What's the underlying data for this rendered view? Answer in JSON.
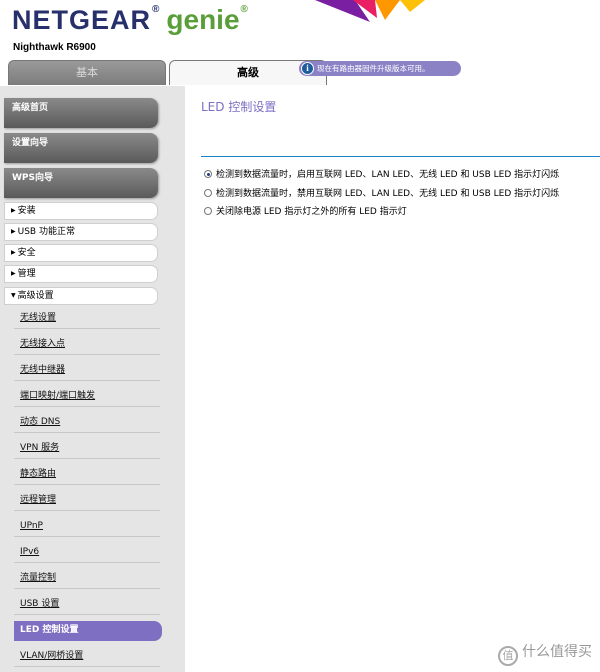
{
  "header": {
    "brand": "NETGEAR",
    "reg_mark": "®",
    "product": "genie",
    "product_reg": "®",
    "model": "Nighthawk R6900"
  },
  "tabs": [
    {
      "label": "基本",
      "active": false
    },
    {
      "label": "高级",
      "active": true
    }
  ],
  "notice": {
    "icon": "info-icon",
    "text": "现在有路由器固件升级版本可用。"
  },
  "sidebar": {
    "big_buttons": [
      "高级首页",
      "设置向导",
      "WPS向导"
    ],
    "menu": [
      {
        "label": "安装",
        "expanded": false
      },
      {
        "label": "USB 功能正常",
        "expanded": false
      },
      {
        "label": "安全",
        "expanded": false
      },
      {
        "label": "管理",
        "expanded": false
      },
      {
        "label": "高级设置",
        "expanded": true
      }
    ],
    "subitems": [
      "无线设置",
      "无线接入点",
      "无线中继器",
      "端口映射/端口触发",
      "动态 DNS",
      "VPN 服务",
      "静态路由",
      "远程管理",
      "UPnP",
      "IPv6",
      "流量控制",
      "USB 设置",
      "LED 控制设置",
      "VLAN/网桥设置"
    ],
    "active_subitem": "LED 控制设置"
  },
  "content": {
    "title": "LED 控制设置",
    "options": [
      {
        "label": "检测到数据流量时，启用互联网 LED、LAN LED、无线 LED 和 USB LED 指示灯闪烁",
        "checked": true
      },
      {
        "label": "检测到数据流量时，禁用互联网 LED、LAN LED、无线 LED 和 USB LED 指示灯闪烁",
        "checked": false
      },
      {
        "label": "关闭除电源 LED 指示灯之外的所有 LED 指示灯",
        "checked": false
      }
    ]
  },
  "watermark": {
    "icon": "zhi-icon",
    "icon_glyph": "值",
    "text": "什么值得买"
  },
  "colors": {
    "brand_blue": "#28306b",
    "genie_green": "#5a9e3a",
    "accent_purple": "#7f6fc2",
    "divider_blue": "#1d84c4"
  }
}
